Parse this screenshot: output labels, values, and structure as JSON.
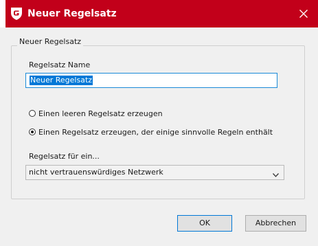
{
  "window": {
    "title": "Neuer Regelsatz",
    "title_bar_color": "#c2001a",
    "logo_icon": "gdata-logo-icon",
    "close_icon": "close-icon"
  },
  "group": {
    "legend": "Neuer Regelsatz"
  },
  "name_field": {
    "label": "Regelsatz Name",
    "value": "Neuer Regelsatz",
    "value_selected": true
  },
  "options": [
    {
      "label": "Einen leeren Regelsatz erzeugen",
      "checked": false
    },
    {
      "label": "Einen Regelsatz erzeugen, der einige sinnvolle Regeln enthält",
      "checked": true
    }
  ],
  "network": {
    "label": "Regelsatz für ein...",
    "selected": "nicht vertrauenswürdiges Netzwerk",
    "dropdown_icon": "chevron-down-icon"
  },
  "buttons": {
    "ok": "OK",
    "cancel": "Abbrechen"
  }
}
